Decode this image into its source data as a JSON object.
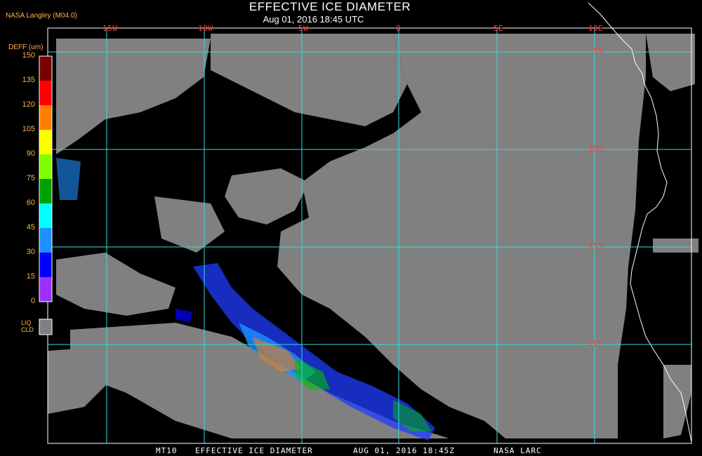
{
  "header": {
    "title": "EFFECTIVE ICE DIAMETER",
    "subtitle": "Aug 01, 2016 18:45 UTC",
    "producer": "NASA Langley (M04.0)"
  },
  "legend": {
    "unit_label": "DEFF (um)",
    "ticks": [
      "150",
      "135",
      "120",
      "105",
      "90",
      "75",
      "60",
      "45",
      "30",
      "15",
      "0"
    ],
    "colors": [
      "#7a0000",
      "#ff0000",
      "#ff8000",
      "#ffff00",
      "#7fff00",
      "#00a000",
      "#00ffff",
      "#1e90ff",
      "#0000ff",
      "#9b30ff"
    ],
    "liquid_label_1": "LIQ",
    "liquid_label_2": "CLD",
    "liquid_color": "#808080"
  },
  "map": {
    "longitude_labels": [
      "15W",
      "10W",
      "5W",
      "0",
      "5E",
      "10E"
    ],
    "latitude_labels": [
      "5S",
      "10S",
      "15S",
      "20S"
    ],
    "grid_color": "#33dddd",
    "cloud_color": "#808080",
    "coast_color": "#ffffff"
  },
  "footer": {
    "product": "MT10",
    "title": "EFFECTIVE ICE DIAMETER",
    "date": "AUG 01, 2016 18:45Z",
    "org": "NASA LARC"
  }
}
